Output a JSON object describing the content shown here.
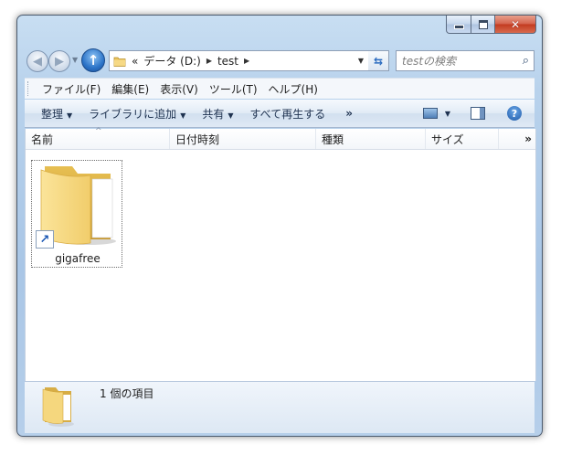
{
  "address": {
    "overflow": "«",
    "drive": "データ (D:)",
    "folder": "test"
  },
  "search": {
    "placeholder": "testの検索"
  },
  "menu": [
    "ファイル(F)",
    "編集(E)",
    "表示(V)",
    "ツール(T)",
    "ヘルプ(H)"
  ],
  "commands": {
    "organize": "整理",
    "library": "ライブラリに追加",
    "share": "共有",
    "playall": "すべて再生する",
    "more": "»"
  },
  "columns": {
    "name": "名前",
    "date": "日付時刻",
    "type": "種類",
    "size": "サイズ",
    "more": "»"
  },
  "items": [
    {
      "name": "gigafree"
    }
  ],
  "status": {
    "count": "1 個の項目"
  },
  "colors": {
    "folder": "#f3d27a",
    "accent": "#2c74c8",
    "close": "#c23a1f"
  }
}
